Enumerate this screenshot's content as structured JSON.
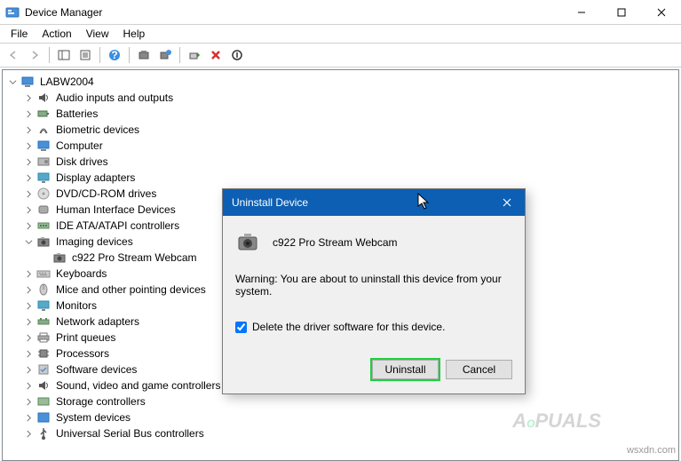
{
  "window": {
    "title": "Device Manager"
  },
  "menu": {
    "file": "File",
    "action": "Action",
    "view": "View",
    "help": "Help"
  },
  "tree": {
    "root": "LABW2004",
    "items": [
      "Audio inputs and outputs",
      "Batteries",
      "Biometric devices",
      "Computer",
      "Disk drives",
      "Display adapters",
      "DVD/CD-ROM drives",
      "Human Interface Devices",
      "IDE ATA/ATAPI controllers",
      "Imaging devices",
      "Keyboards",
      "Mice and other pointing devices",
      "Monitors",
      "Network adapters",
      "Print queues",
      "Processors",
      "Software devices",
      "Sound, video and game controllers",
      "Storage controllers",
      "System devices",
      "Universal Serial Bus controllers"
    ],
    "imaging_child": "c922 Pro Stream Webcam"
  },
  "dialog": {
    "title": "Uninstall Device",
    "device_name": "c922 Pro Stream Webcam",
    "warning": "Warning: You are about to uninstall this device from your system.",
    "checkbox": "Delete the driver software for this device.",
    "uninstall": "Uninstall",
    "cancel": "Cancel"
  },
  "watermark": "wsxdn.com"
}
